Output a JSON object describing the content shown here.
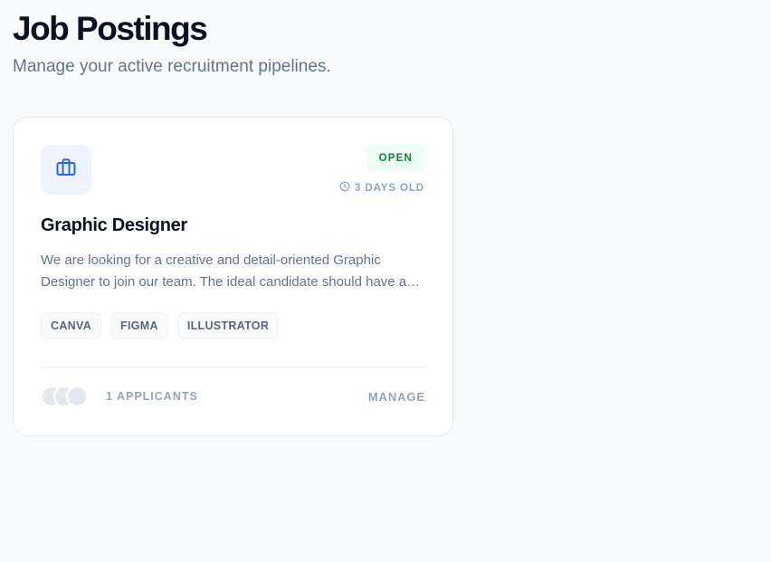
{
  "header": {
    "title": "Job Postings",
    "subtitle": "Manage your active recruitment pipelines."
  },
  "job": {
    "icon": "briefcase-icon",
    "status": "OPEN",
    "age": "3 DAYS OLD",
    "title": "Graphic Designer",
    "description": "We are looking for a creative and detail-oriented Graphic Designer to join our team. The ideal candidate should have a strong portfolio.",
    "tags": [
      "CANVA",
      "FIGMA",
      "ILLUSTRATOR"
    ],
    "applicants_label": "1 APPLICANTS",
    "manage_label": "MANAGE"
  },
  "colors": {
    "status_bg": "#ecfdf3",
    "status_text": "#15803d",
    "icon_accent": "#2563eb",
    "muted": "#94a3b8"
  }
}
